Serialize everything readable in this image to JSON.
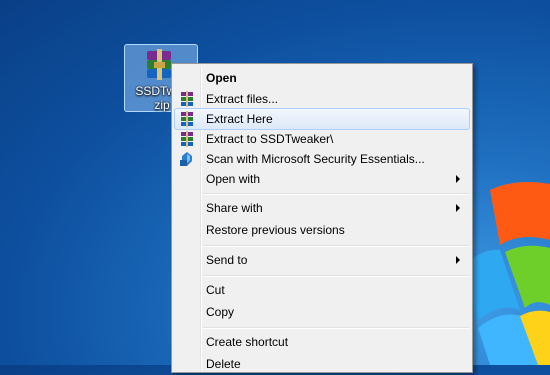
{
  "desktop": {
    "icon_label_line1": "SSDTwea",
    "icon_label_line2": "zip"
  },
  "menu": {
    "items": [
      {
        "label": "Open"
      },
      {
        "label": "Extract files..."
      },
      {
        "label": "Extract Here"
      },
      {
        "label": "Extract to SSDTweaker\\"
      },
      {
        "label": "Scan with Microsoft Security Essentials..."
      },
      {
        "label": "Open with"
      },
      {
        "label": "Share with"
      },
      {
        "label": "Restore previous versions"
      },
      {
        "label": "Send to"
      },
      {
        "label": "Cut"
      },
      {
        "label": "Copy"
      },
      {
        "label": "Create shortcut"
      },
      {
        "label": "Delete"
      }
    ]
  },
  "icons": {
    "winrar": "winrar-icon",
    "mse": "security-essentials-icon",
    "submenu": "chevron-right-icon"
  },
  "colors": {
    "desktop": "#1f6fc0",
    "menu_bg": "#f0f0f0",
    "hover_border": "#aecff7"
  }
}
